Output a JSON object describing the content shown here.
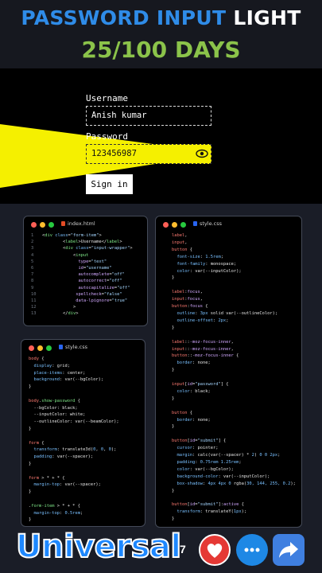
{
  "header": {
    "title_blue": "PASSWORD INPUT",
    "title_white": "LIGHT",
    "progress": "25/100 DAYS"
  },
  "demo": {
    "username_label": "Username",
    "username_value": "Anish kumar",
    "password_label": "Password",
    "password_value": "123456987",
    "signin_label": "Sign in",
    "beam_color": "#f5f000"
  },
  "panes": {
    "html_file": "index.html",
    "css_file_1": "style.css",
    "css_file_2": "style.css"
  },
  "overlay": {
    "brand": "Universal",
    "number": "7"
  }
}
